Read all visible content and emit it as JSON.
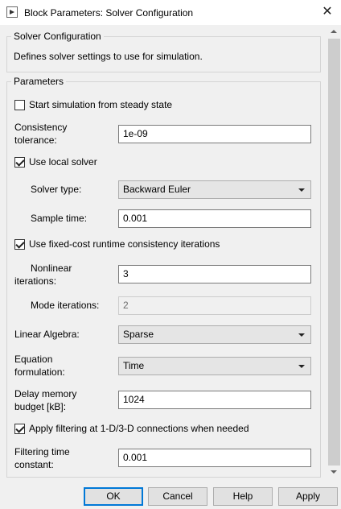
{
  "window": {
    "title": "Block Parameters: Solver Configuration",
    "close_icon": "close-icon"
  },
  "description_group": {
    "title": "Solver Configuration",
    "text": "Defines solver settings to use for simulation."
  },
  "parameters": {
    "title": "Parameters",
    "start_steady_state": {
      "label": "Start simulation from steady state",
      "checked": false
    },
    "consistency_tolerance": {
      "label_line1": "Consistency",
      "label_line2": "tolerance:",
      "value": "1e-09"
    },
    "use_local_solver": {
      "label": "Use local solver",
      "checked": true
    },
    "solver_type": {
      "label": "Solver type:",
      "value": "Backward Euler"
    },
    "sample_time": {
      "label": "Sample time:",
      "value": "0.001"
    },
    "fixed_cost": {
      "label": "Use fixed-cost runtime consistency iterations",
      "checked": true
    },
    "nonlinear_iterations": {
      "label_line1": "Nonlinear",
      "label_line2": "iterations:",
      "value": "3"
    },
    "mode_iterations": {
      "label": "Mode iterations:",
      "value": "2",
      "enabled": false
    },
    "linear_algebra": {
      "label": "Linear Algebra:",
      "value": "Sparse"
    },
    "equation_formulation": {
      "label_line1": "Equation",
      "label_line2": "formulation:",
      "value": "Time"
    },
    "delay_memory": {
      "label_line1": "Delay memory",
      "label_line2": "budget [kB]:",
      "value": "1024"
    },
    "apply_filtering": {
      "label": "Apply filtering at 1-D/3-D connections when needed",
      "checked": true
    },
    "filtering_time_constant": {
      "label_line1": "Filtering time",
      "label_line2": "constant:",
      "value": "0.001"
    }
  },
  "buttons": {
    "ok": "OK",
    "cancel": "Cancel",
    "help": "Help",
    "apply": "Apply"
  },
  "colors": {
    "default_button_border": "#0078d7",
    "window_bg": "#f0f0f0"
  }
}
